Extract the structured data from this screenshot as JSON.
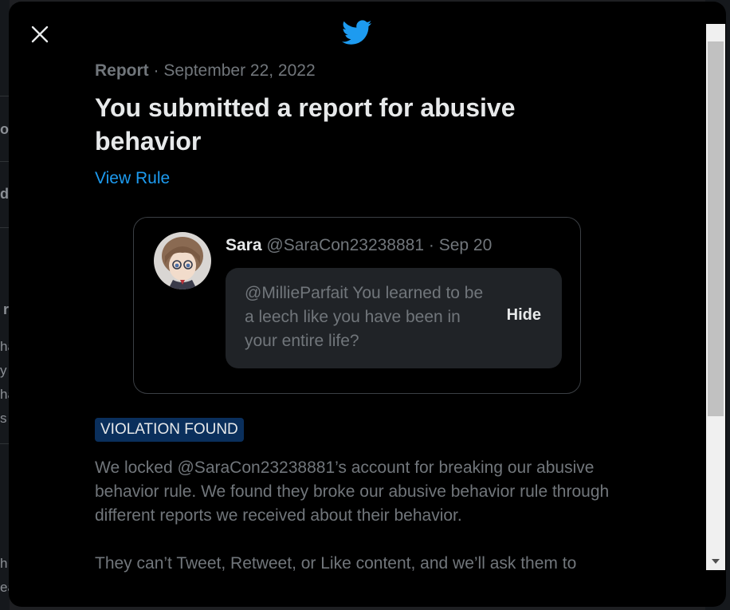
{
  "background": {
    "fragments": [
      "o",
      "d",
      "r",
      "ha",
      "y",
      "ha",
      "s",
      "h",
      "ea",
      "y"
    ]
  },
  "modal": {
    "close_icon": "close-icon",
    "logo_icon": "twitter-bird-icon",
    "meta": {
      "type": "Report",
      "separator": " · ",
      "date": "September 22, 2022"
    },
    "title": "You submitted a report for abusive behavior",
    "view_rule_link": "View Rule",
    "tweet": {
      "name": "Sara",
      "handle": "@SaraCon23238881",
      "separator": " · ",
      "date": "Sep 20",
      "text": "@MillieParfait You learned to be a leech like you have been in your entire life?",
      "hide_label": "Hide"
    },
    "badge": "VIOLATION FOUND",
    "description": [
      "We locked @SaraCon23238881’s account for breaking our abusive behavior rule. We found they broke our abusive behavior rule through different reports we received about their behavior.",
      "They can’t Tweet, Retweet, or Like content, and we’ll ask them to"
    ]
  },
  "colors": {
    "accent": "#1d9bf0",
    "badge_bg": "#0a2f5c",
    "modal_bg": "#000000"
  }
}
